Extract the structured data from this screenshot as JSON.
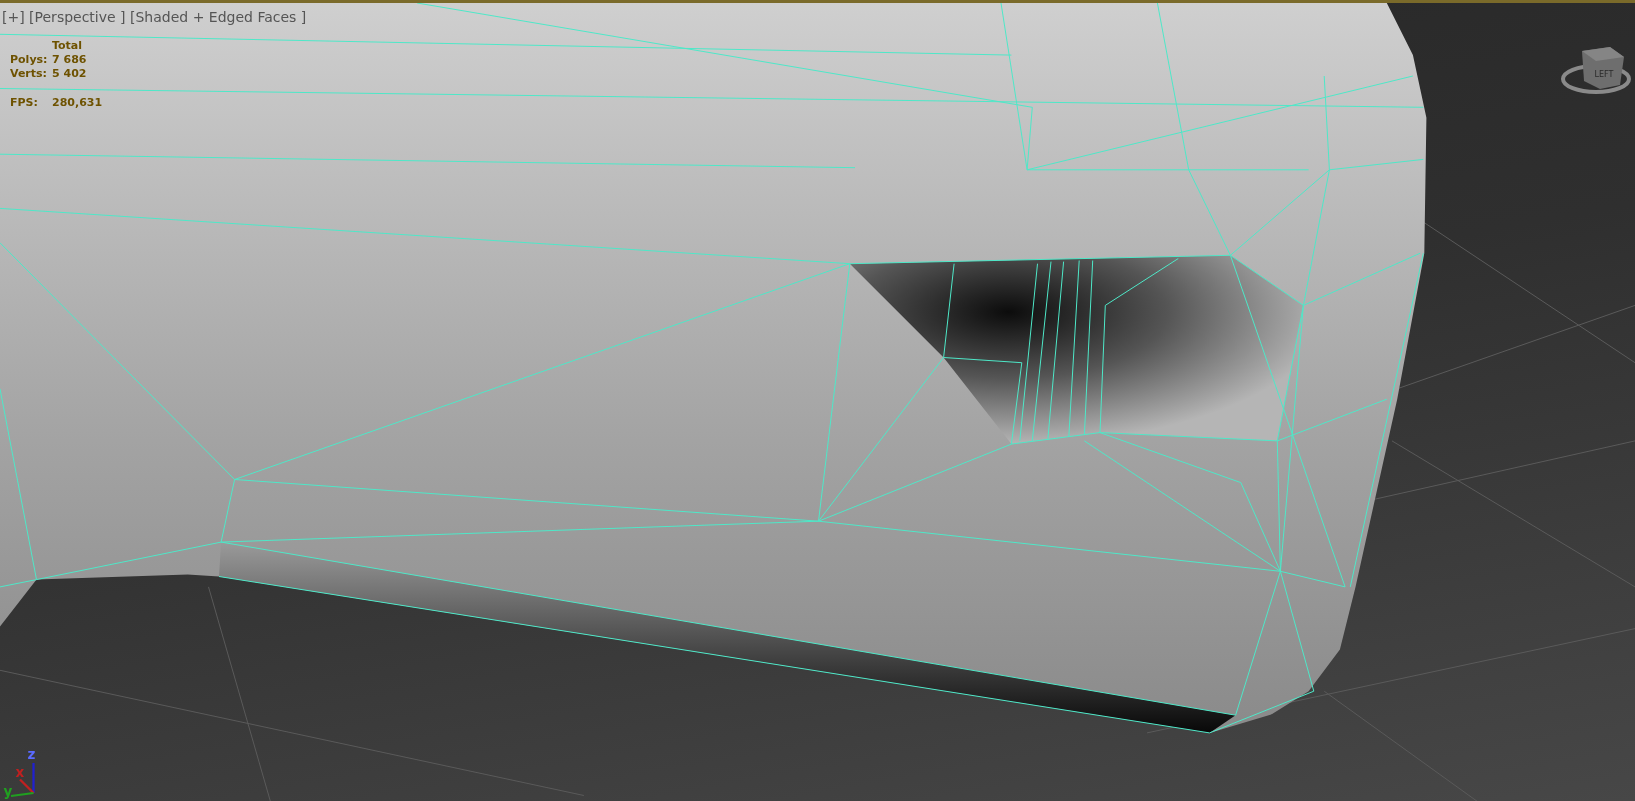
{
  "viewport": {
    "label": "[+] [Perspective ] [Shaded + Edged Faces ]",
    "stats": {
      "header": "Total",
      "rows": [
        {
          "label": "Polys:",
          "value": "7 686"
        },
        {
          "label": "Verts:",
          "value": "5 402"
        }
      ],
      "fps": {
        "label": "FPS:",
        "value": "280,631"
      }
    },
    "viewcube": {
      "face": "LEFT"
    },
    "axes": [
      {
        "kind": "z",
        "label": "z"
      },
      {
        "kind": "x",
        "label": "x"
      },
      {
        "kind": "y",
        "label": "y"
      }
    ]
  }
}
